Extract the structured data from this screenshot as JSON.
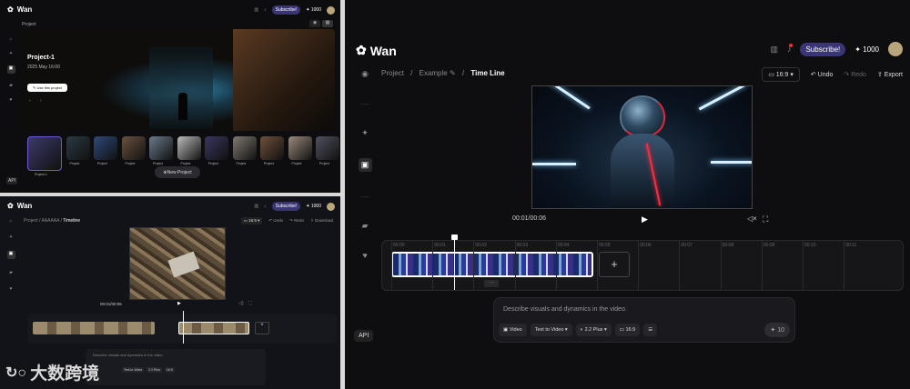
{
  "app": {
    "name": "Wan"
  },
  "colors": {
    "accent": "#5b55d6",
    "bg": "#0d0d0f",
    "page_gray": "#d9d9d9",
    "subscribe_bg": "#3a3575"
  },
  "header": {
    "subscribe": "Subscribe!",
    "credits": "1000",
    "credit_icon": "plus-icon"
  },
  "projects_view": {
    "project_label": "Project",
    "title": "Project-1",
    "date": "2025 May 16:00",
    "use_button": "Use this project",
    "new_project": "New Project",
    "thumbnails": [
      "Project-1",
      "Project",
      "Project",
      "Project",
      "Project",
      "Project",
      "Project",
      "Project",
      "Project",
      "Project",
      "Project"
    ]
  },
  "timeline_small": {
    "breadcrumb": [
      "Project",
      "AAAAAA",
      "Timeline"
    ],
    "aspect": "16:9",
    "undo": "Undo",
    "redo": "Redo",
    "download": "Download",
    "time": "00:01/00:06",
    "prompt": "Describe visuals and dynamics in the video.",
    "mode": "Text to Video",
    "model": "2.2 Plus",
    "ratio": "16:9"
  },
  "timeline_large": {
    "breadcrumb": [
      "Project",
      "Example",
      "Time Line"
    ],
    "aspect": "16:9",
    "undo": "Undo",
    "redo": "Redo",
    "export": "Export",
    "time": "00:01/00:06",
    "ticks": [
      "00:00",
      "00:01",
      "00:02",
      "00:03",
      "00:04",
      "00:05",
      "00:06",
      "00:07",
      "00:08",
      "00:09",
      "00:10",
      "00:11"
    ],
    "prompt": "Describe visuals and dynamics in the video.",
    "video": "Video",
    "mode": "Text to Video",
    "model": "2.2 Plus",
    "ratio": "16:9",
    "cost": "10"
  },
  "sidebar": {
    "api": "API"
  },
  "watermark": {
    "text": "大数跨境"
  }
}
